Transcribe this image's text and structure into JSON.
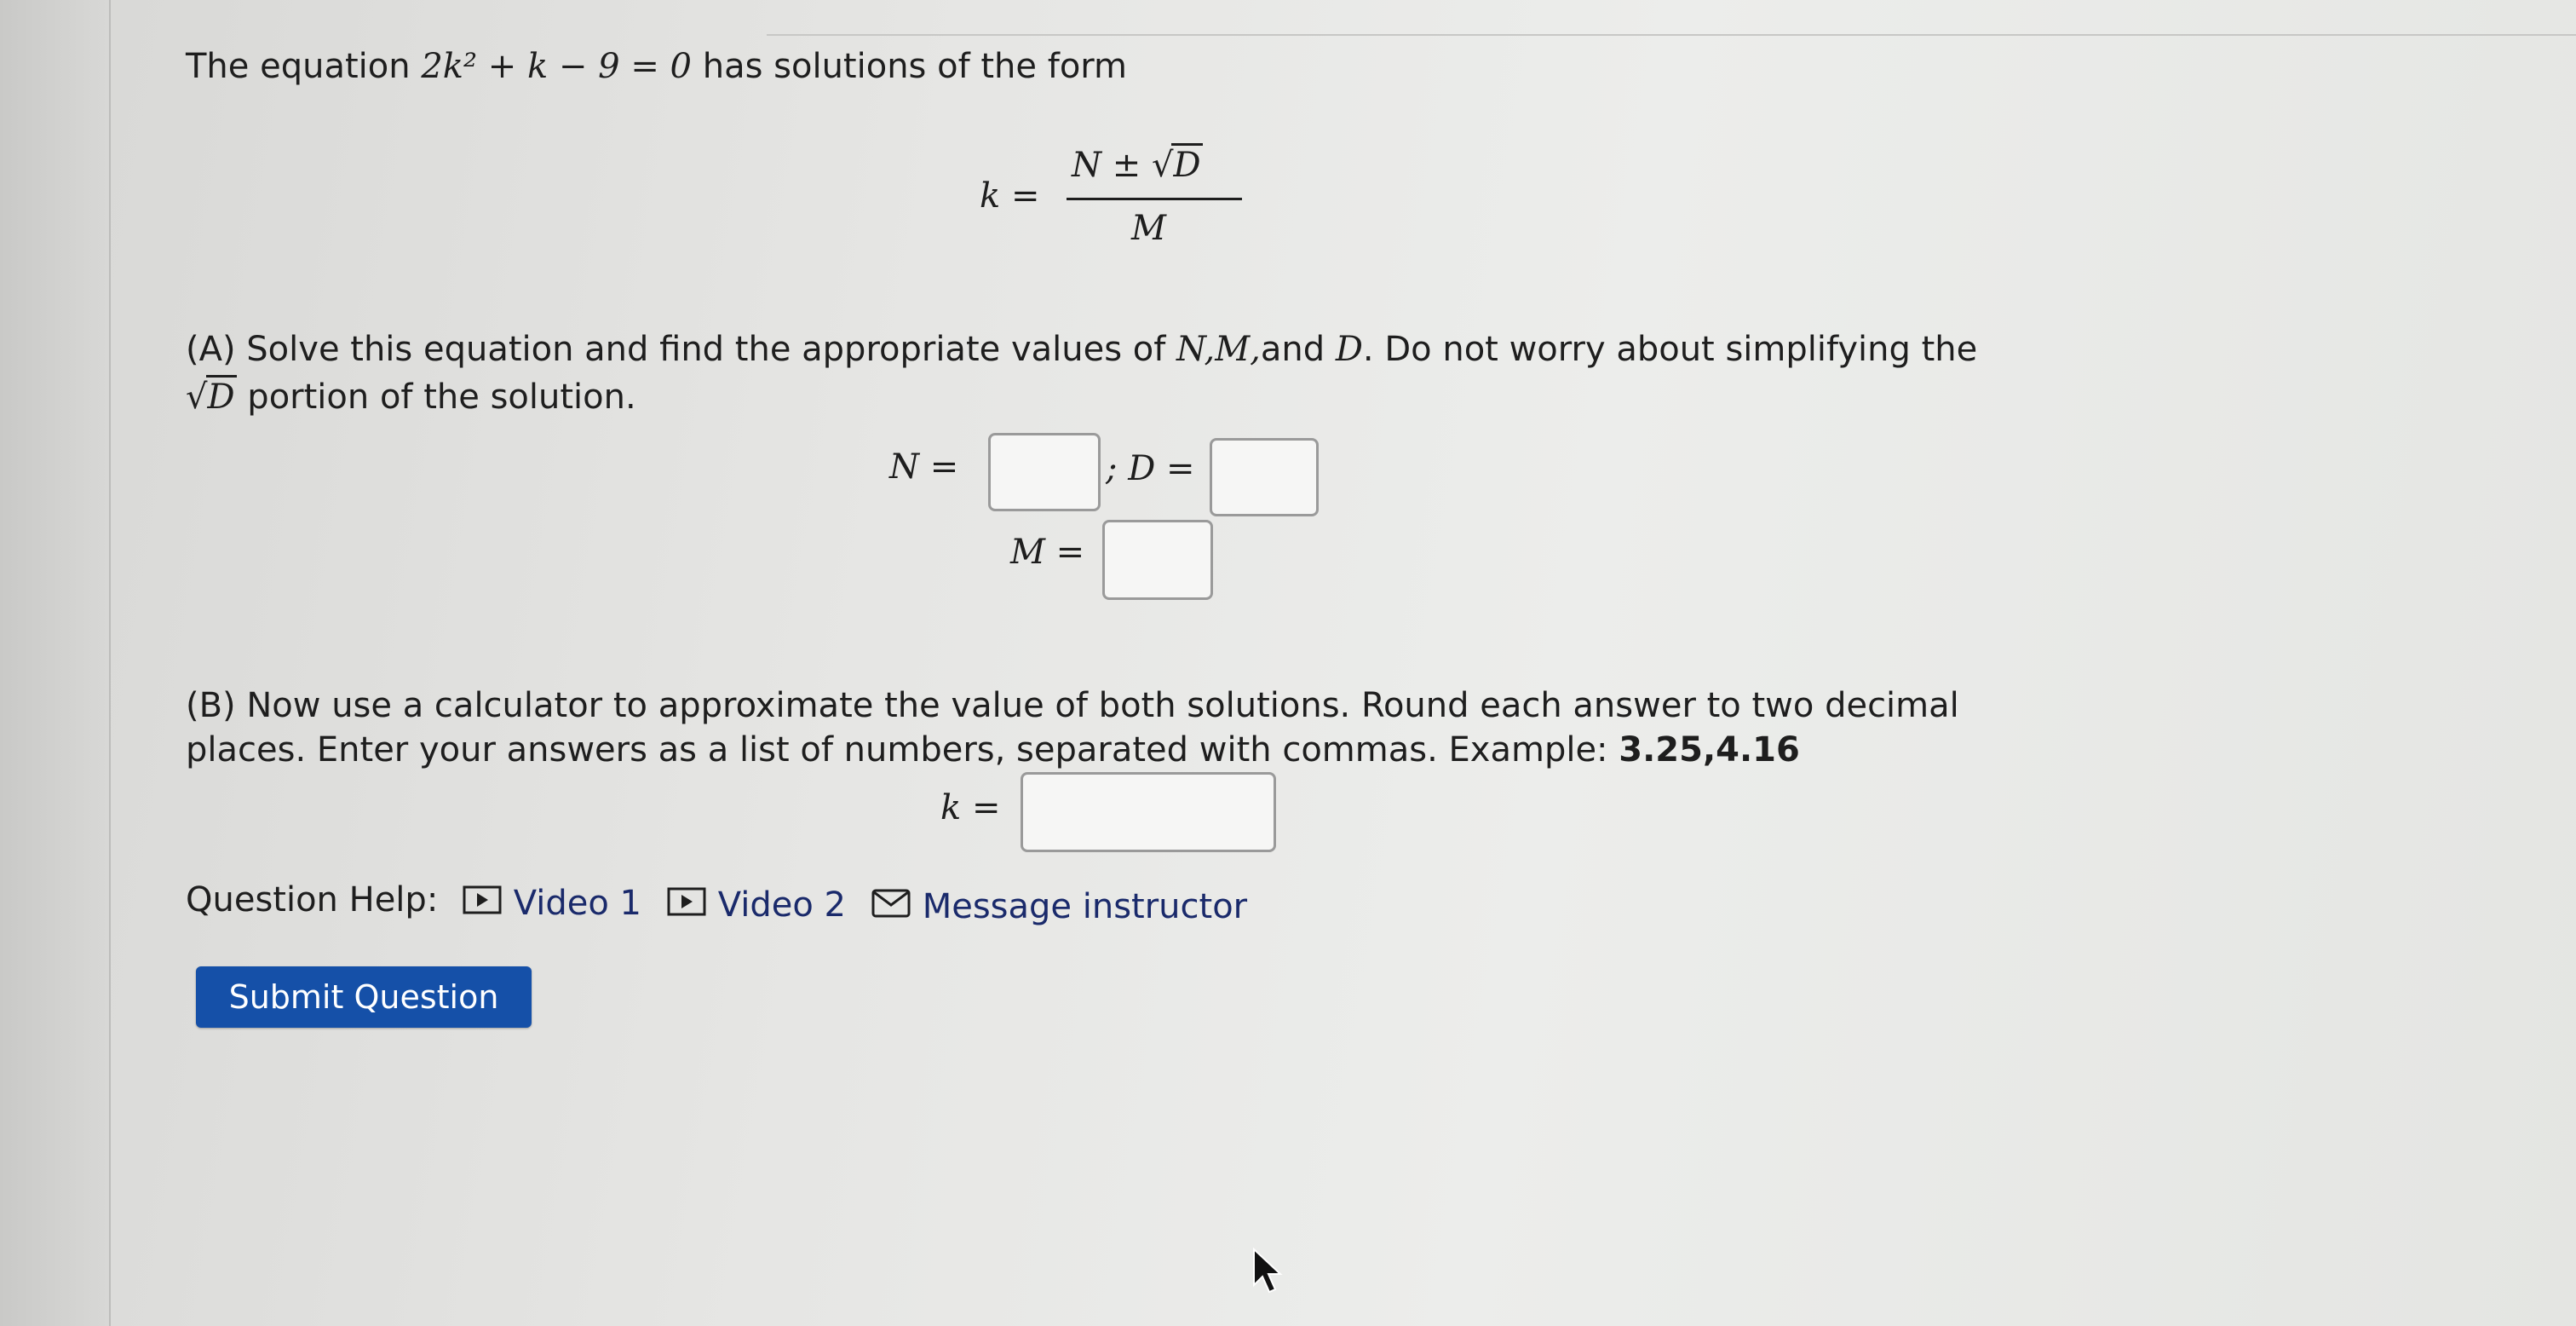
{
  "intro": {
    "prefix": "The equation",
    "equation": "2k² + k − 9 = 0",
    "suffix": "has solutions of the form"
  },
  "formula": {
    "lhs": "k =",
    "numerator_n": "N ±",
    "numerator_d": "D",
    "denominator": "M"
  },
  "part_a": {
    "text_start": "(A) Solve this equation and find the appropriate values of",
    "vars": "N,M,",
    "and": "and",
    "var_d": "D",
    "text_end": ". Do not worry about simplifying the",
    "line2_sqrt": "D",
    "line2_rest": "portion of the solution.",
    "n_label": "N =",
    "d_label": "; D =",
    "m_label": "M =",
    "n_value": "",
    "d_value": "",
    "m_value": ""
  },
  "part_b": {
    "line1": "(B) Now use a calculator to approximate the value of both solutions. Round each answer to two decimal",
    "line2": "places. Enter your answers as a list of numbers, separated with commas. Example:",
    "example": "3.25,4.16",
    "k_label": "k =",
    "k_value": ""
  },
  "help": {
    "label": "Question Help:",
    "video1": "Video 1",
    "video2": "Video 2",
    "message": "Message instructor"
  },
  "submit": {
    "label": "Submit Question"
  },
  "colors": {
    "submit_bg": "#1550a8",
    "link": "#1a2a6b"
  }
}
